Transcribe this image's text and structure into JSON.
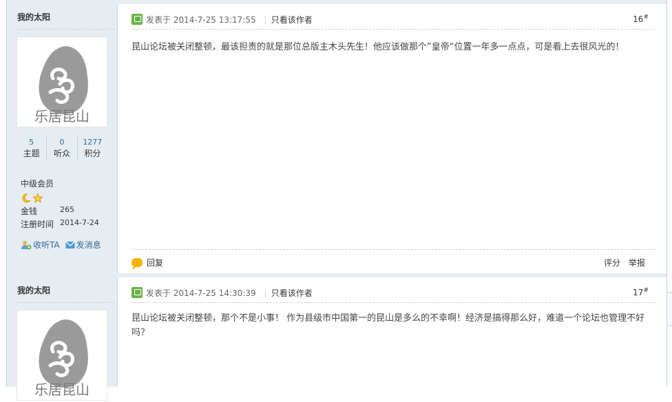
{
  "posts": [
    {
      "user": {
        "name": "我的太阳",
        "avatar_text": "乐居昆山",
        "stats": [
          {
            "value": "5",
            "label": "主题"
          },
          {
            "value": "0",
            "label": "听众"
          },
          {
            "value": "1277",
            "label": "积分"
          }
        ],
        "level": "中级会员",
        "money_label": "金钱",
        "money": "265",
        "reg_label": "注册时间",
        "reg_date": "2014-7-24",
        "follow_label": "收听TA",
        "message_label": "发消息"
      },
      "posted": "发表于 2014-7-25 13:17:55",
      "only_author": "只看该作者",
      "floor": "16",
      "floor_sup": "#",
      "content": "昆山论坛被关闭整顿，最该担责的就是那位总版主木头先生！他应该做那个”皇帝“位置一年多一点点，可是看上去很风光的！",
      "reply_label": "回复",
      "rate_label": "评分",
      "report_label": "举报"
    },
    {
      "user": {
        "name": "我的太阳",
        "avatar_text": "乐居昆山"
      },
      "posted": "发表于 2014-7-25 14:30:39",
      "only_author": "只看该作者",
      "floor": "17",
      "floor_sup": "#",
      "content": "昆山论坛被关闭整顿，那个不是小事！ 作为县级市中国第一的昆山是多么的不幸啊！经济是搞得那么好，难道一个论坛也管理不好吗？"
    }
  ],
  "colors": {
    "sidebar_bg": "#e5edf2",
    "border": "#c2d5e3",
    "link": "#336699",
    "online": "#6bb245",
    "reply_icon": "#f5b300"
  }
}
